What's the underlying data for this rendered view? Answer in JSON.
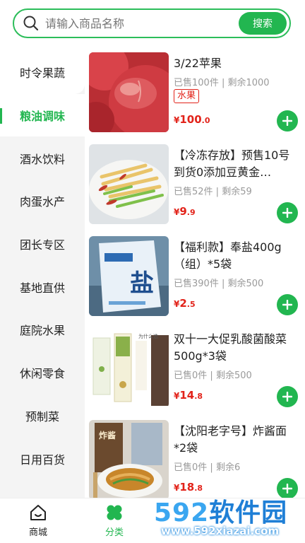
{
  "search": {
    "placeholder": "请输入商品名称",
    "button_label": "搜索"
  },
  "sidebar": {
    "items": [
      {
        "label": "时令果蔬"
      },
      {
        "label": "粮油调味"
      },
      {
        "label": "酒水饮料"
      },
      {
        "label": "肉蛋水产"
      },
      {
        "label": "团长专区"
      },
      {
        "label": "基地直供"
      },
      {
        "label": "庭院水果"
      },
      {
        "label": "休闲零食"
      },
      {
        "label": "预制菜"
      },
      {
        "label": "日用百货"
      }
    ],
    "active_index": 1
  },
  "products": [
    {
      "title": "3/22苹果",
      "sold": "已售100件",
      "remain": "剩余1000",
      "tag": "水果",
      "currency": "¥",
      "price_int": "100",
      "price_dec": ".0",
      "image": "apple"
    },
    {
      "title": "【冷冻存放】预售10号到货0添加豆黄金…",
      "sold": "已售52件",
      "remain": "剩余59",
      "currency": "¥",
      "price_int": "9",
      "price_dec": ".9",
      "image": "tofu-skin-dish"
    },
    {
      "title": "【福利款】奉盐400g（组）*5袋",
      "sold": "已售390件",
      "remain": "剩余500",
      "currency": "¥",
      "price_int": "2",
      "price_dec": ".5",
      "image": "salt-bag"
    },
    {
      "title": "双十一大促乳酸菌酸菜500g*3袋",
      "sold": "已售0件",
      "remain": "剩余500",
      "currency": "¥",
      "price_int": "14",
      "price_dec": ".8",
      "image": "sauerkraut-package"
    },
    {
      "title": "【沈阳老字号】炸酱面*2袋",
      "sold": "已售0件",
      "remain": "剩余6",
      "currency": "¥",
      "price_int": "18",
      "price_dec": ".8",
      "image": "noodles-package"
    }
  ],
  "tabbar": {
    "items": [
      {
        "label": "商城",
        "icon": "home-icon"
      },
      {
        "label": "分类",
        "icon": "clover-icon"
      }
    ],
    "active_index": 1
  },
  "watermark": {
    "logo_num": "592",
    "logo_cn": "软件园",
    "url": "www.592xiazai.com"
  },
  "colors": {
    "accent": "#22b650",
    "price": "#e2231a",
    "sidebar_bg": "#f4f4f4"
  }
}
